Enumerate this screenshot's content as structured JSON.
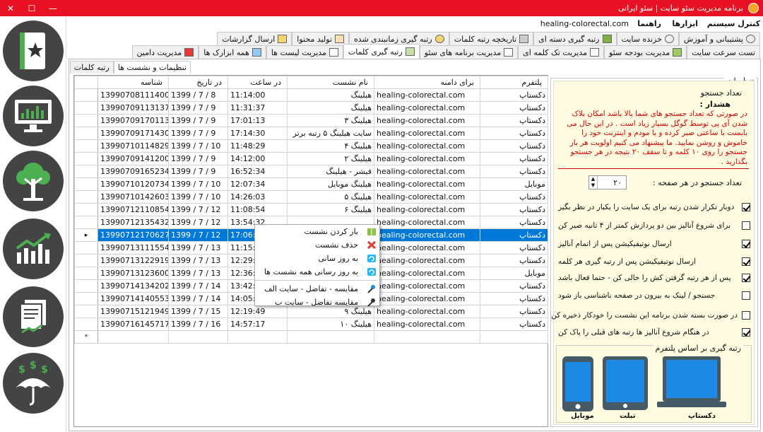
{
  "window": {
    "title": "برنامه مدیریت سئو سایت | سئو ایرانی",
    "minimize": "—",
    "maximize": "☐",
    "close": "✕"
  },
  "menubar": {
    "items": [
      "کنترل سیستم",
      "ابزارها",
      "راهنما"
    ],
    "domain": "healing-colorectal.com"
  },
  "tabs_row1": [
    {
      "label": "پشتیبانی و آموزش",
      "icon": "gear-icon"
    },
    {
      "label": "خزنده سایت",
      "icon": "gear-icon"
    },
    {
      "label": "رتبه گیری دسته ای",
      "icon": "grid-icon"
    },
    {
      "label": "تاریخچه رتبه کلمات",
      "icon": "calculator-icon"
    },
    {
      "label": "رتبه گیری زمانبندی شده",
      "icon": "clock-icon"
    },
    {
      "label": "تولید محتوا",
      "icon": "pen-icon"
    },
    {
      "label": "ارسال گزارشات",
      "icon": "lock-icon"
    }
  ],
  "tabs_row2": [
    {
      "label": "تست سرعت سایت",
      "icon": ""
    },
    {
      "label": "مدیریت بودجه سئو",
      "icon": "money-icon"
    },
    {
      "label": "مدیریت تک کلمه ای",
      "icon": "doc-icon"
    },
    {
      "label": "مدیریت برنامه های سئو",
      "icon": "doc-icon"
    },
    {
      "label": "رتبه گیری کلمات",
      "icon": "doc-icon",
      "active": true
    },
    {
      "label": "مدیریت لیست ها",
      "icon": "list-icon"
    },
    {
      "label": "همه ابزارک ها",
      "icon": "calendar-icon"
    },
    {
      "label": "مدیریت دامین",
      "icon": "book-icon"
    }
  ],
  "subtabs": [
    {
      "label": "تنظیمات و نشست ها",
      "active": true
    },
    {
      "label": "رتبه کلمات",
      "active": false
    }
  ],
  "grid": {
    "columns": [
      "پلتفرم",
      "برای دامنه",
      "نام نشست",
      "در ساعت",
      "در تاریخ",
      "شناسه"
    ],
    "rows": [
      [
        "دکستاپ",
        "healing-colorectal.com",
        "هیلینگ",
        "11:14:00",
        "1399 / 7 / 8",
        "13990708111400"
      ],
      [
        "دکستاپ",
        "healing-colorectal.com",
        "هیلینگ",
        "11:31:37",
        "1399 / 7 / 9",
        "13990709113137"
      ],
      [
        "دکستاپ",
        "healing-colorectal.com",
        "هیلینگ ۳",
        "17:01:13",
        "1399 / 7 / 9",
        "13990709170113"
      ],
      [
        "دکستاپ",
        "healing-colorectal.com",
        "سایت هیلینگ ۵ رتبه برتر",
        "17:14:30",
        "1399 / 7 / 9",
        "13990709171430"
      ],
      [
        "دکستاپ",
        "healing-colorectal.com",
        "هیلینگ ۴",
        "11:48:29",
        "1399 / 7 / 10",
        "13990710114829"
      ],
      [
        "دکستاپ",
        "healing-colorectal.com",
        "هیلینگ ۲",
        "14:12:00",
        "1399 / 7 / 9",
        "13990709141200"
      ],
      [
        "دکستاپ",
        "healing-colorectal.com",
        "فیشر - هیلینگ",
        "16:52:34",
        "1399 / 7 / 9",
        "13990709165234"
      ],
      [
        "موبایل",
        "healing-colorectal.com",
        "هیلینگ موبایل",
        "12:07:34",
        "1399 / 7 / 10",
        "13990710120734"
      ],
      [
        "دکستاپ",
        "healing-colorectal.com",
        "هیلینگ ۵",
        "14:26:03",
        "1399 / 7 / 10",
        "13990710142603"
      ],
      [
        "دکستاپ",
        "healing-colorectal.com",
        "هیلینگ ۶",
        "11:08:54",
        "1399 / 7 / 12",
        "13990712110854"
      ],
      [
        "دکستاپ",
        "healing-colorectal.com",
        "",
        "13:54:32",
        "1399 / 7 / 12",
        "13990712135432"
      ],
      [
        "دکستاپ",
        "healing-colorectal.com",
        "",
        "17:06:27",
        "1399 / 7 / 12",
        "13990712170627"
      ],
      [
        "دکستاپ",
        "healing-colorectal.com",
        "",
        "11:15:54",
        "1399 / 7 / 13",
        "13990713111554"
      ],
      [
        "دکستاپ",
        "healing-colorectal.com",
        "",
        "12:29:19",
        "1399 / 7 / 13",
        "13990713122919"
      ],
      [
        "موبایل",
        "healing-colorectal.com",
        "",
        "12:36:00",
        "1399 / 7 / 13",
        "13990713123600"
      ],
      [
        "دکستاپ",
        "healing-colorectal.com",
        "",
        "13:42:02",
        "1399 / 7 / 14",
        "13990714134202"
      ],
      [
        "دکستاپ",
        "healing-colorectal.com",
        "",
        "14:05:53",
        "1399 / 7 / 14",
        "13990714140553"
      ],
      [
        "دکستاپ",
        "healing-colorectal.com",
        "هیلینگ ۹",
        "12:19:49",
        "1399 / 7 / 15",
        "13990715121949"
      ],
      [
        "دکستاپ",
        "healing-colorectal.com",
        "هیلینگ ۱۰",
        "14:57:17",
        "1399 / 7 / 16",
        "13990716145717"
      ]
    ],
    "selected_row": 11,
    "current_marker": "▸",
    "new_row_marker": "*"
  },
  "context_menu": {
    "items": [
      {
        "label": "باز کردن نشست",
        "icon": "open-book-icon"
      },
      {
        "label": "حذف نشست",
        "icon": "delete-x-icon"
      },
      {
        "label": "به روز سانی",
        "icon": "refresh-icon"
      },
      {
        "label": "به روز رسانی همه نشست ها",
        "icon": "refresh-all-icon"
      },
      {
        "label": "مقایسه - تفاضل - سایت الف",
        "icon": "pin-icon"
      },
      {
        "label": "مقایسه تفاضل - سایت ب",
        "icon": "pin-icon"
      }
    ]
  },
  "settings": {
    "group_title": "تنظیمات",
    "search_count_title": "تعداد جستجو",
    "warning_title": "هشدار :",
    "warning_text": "در صورتی که تعداد جستجو های شما بالا باشد امکان بلاک شدن آی پی توسط گوگل بسیار زیاد است . در این حال می بایست با ساعتی صبر کرده و یا مودم و اینترنت خود را خاموش و روشن نمایید. ما پیشنهاد می کنیم اولویت هر بار جستجو را روی ۱۰ کلمه و تا سقف ۲۰ نتیجه در هر جستجو بگذارید .",
    "per_page_label": "تعداد جستجو در هر صفحه :",
    "per_page_value": "۲۰",
    "checkboxes": [
      {
        "label": "دوبار تکرار شدن رتبه برای یک سایت را یکبار در نظر بگیر",
        "checked": true
      },
      {
        "label": "برای شروع آنالیز بین دو پردازش کمتر از ۴ ثانیه صبر کن",
        "checked": false
      },
      {
        "label": "ارسال نوتیفیکیشن پس از اتمام آنالیز",
        "checked": true
      },
      {
        "label": "ارسال نوتیفیکیشن پس از رتبه گیری هر کلمه",
        "checked": true
      },
      {
        "label": "پس از هر رتبه گرفتن کش را خالی کن - حتما فعال باشد",
        "checked": true
      },
      {
        "label": "جستجو / لینک به بیرون در صفحه ناشناسی باز شود",
        "checked": false
      },
      {
        "label": "در صورت بسته شدن برنامه این نشست را خودکار ذخیره کن",
        "checked": false
      },
      {
        "label": "در هنگام شروع آنالیز ها رتبه های قبلی را پاک کن",
        "checked": true
      }
    ],
    "platform_title": "رتبه گیری بر اساس پلتفرم",
    "platforms": [
      "دکستاپ",
      "تبلت",
      "موبایل"
    ]
  },
  "colors": {
    "titlebar": "#e81123",
    "selection": "#0078d7",
    "warning": "#d40000",
    "settings_bg": "#fffbe0",
    "device_blue": "#1e88e5",
    "sidebar_circle": "#444444"
  },
  "sidebar_icons": [
    "favorite-book-icon",
    "monitor-chart-icon",
    "tree-icon",
    "growth-chart-icon",
    "report-icon",
    "money-umbrella-icon"
  ]
}
